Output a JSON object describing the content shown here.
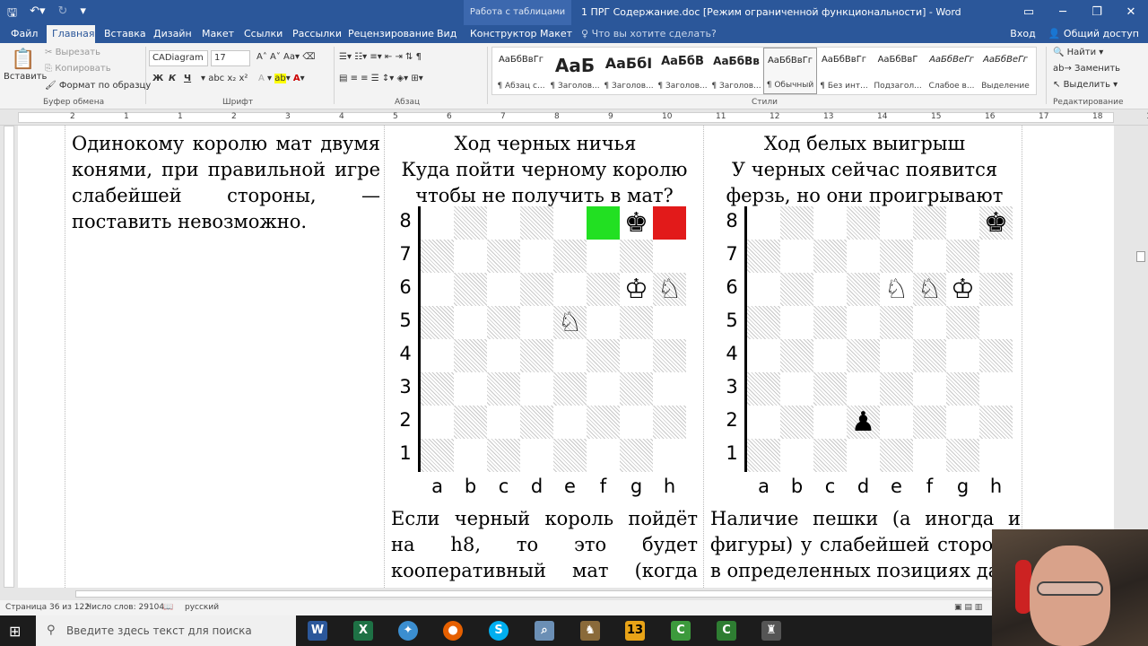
{
  "window": {
    "doc_title": "1 ПРГ Содержание.doc [Режим ограниченной функциональности] - Word",
    "context_tab": "Работа с таблицами"
  },
  "tabs": {
    "file": "Файл",
    "home": "Главная",
    "insert": "Вставка",
    "design": "Дизайн",
    "layout": "Макет",
    "references": "Ссылки",
    "mailings": "Рассылки",
    "review": "Рецензирование",
    "view": "Вид",
    "constructor": "Конструктор",
    "table_layout": "Макет",
    "tell_me": "Что вы хотите сделать?",
    "login": "Вход",
    "share": "Общий доступ"
  },
  "clipboard": {
    "paste": "Вставить",
    "cut": "Вырезать",
    "copy": "Копировать",
    "format_painter": "Формат по образцу",
    "group": "Буфер обмена"
  },
  "font": {
    "name": "CADiagram",
    "size": "17",
    "group": "Шрифт",
    "bold": "Ж",
    "italic": "К",
    "underline": "Ч"
  },
  "paragraph": {
    "group": "Абзац"
  },
  "styles": {
    "group": "Стили",
    "items": [
      {
        "preview": "АаБбВвГг",
        "name": "¶ Абзац с..."
      },
      {
        "preview": "АаБ",
        "name": "¶ Заголов..."
      },
      {
        "preview": "АаБбI",
        "name": "¶ Заголов..."
      },
      {
        "preview": "АаБбВ",
        "name": "¶ Заголов..."
      },
      {
        "preview": "АаБбВв",
        "name": "¶ Заголов..."
      },
      {
        "preview": "АаБбВвГг",
        "name": "¶ Обычный"
      },
      {
        "preview": "АаБбВвГг",
        "name": "¶ Без инт..."
      },
      {
        "preview": "АаБбВвГ",
        "name": "Подзагол..."
      },
      {
        "preview": "АаБбВеГг",
        "name": "Слабое в..."
      },
      {
        "preview": "АаБбВеГг",
        "name": "Выделение"
      }
    ]
  },
  "editing": {
    "find": "Найти",
    "replace": "Заменить",
    "select": "Выделить",
    "group": "Редактирование"
  },
  "ruler": {
    "numbers": [
      "2",
      "1",
      "1",
      "2",
      "3",
      "4",
      "5",
      "6",
      "7",
      "8",
      "9",
      "10",
      "11",
      "12",
      "13",
      "14",
      "15",
      "16",
      "17",
      "18",
      "19"
    ]
  },
  "doc": {
    "left_text": "Одинокому королю мат двумя конями, при правильной игре слабейшей стороны, — поставить невозможно.",
    "col2_title": "Ход черных ничья",
    "col2_sub": "Куда пойти черному королю чтобы не получить в мат?",
    "col3_title": "Ход белых выигрыш",
    "col3_sub": "У черных сейчас появится ферзь, но они проигрывают",
    "col2_bottom": "Если черный король пойдёт на h8, то это будет кооперативный мат (когда соперник нам",
    "col3_bottom": "Наличие пешки (а иногда и фигуры) у слабейшей стороны в определенных позициях да"
  },
  "boards": {
    "ranks": [
      "8",
      "7",
      "6",
      "5",
      "4",
      "3",
      "2",
      "1"
    ],
    "files": [
      "a",
      "b",
      "c",
      "d",
      "e",
      "f",
      "g",
      "h"
    ],
    "left": [
      [
        "",
        "",
        "",
        "",
        "",
        "#G",
        "♚",
        "#R"
      ],
      [
        "",
        "",
        "",
        "",
        "",
        "",
        "",
        ""
      ],
      [
        "",
        "",
        "",
        "",
        "",
        "",
        "♔",
        "♘"
      ],
      [
        "",
        "",
        "",
        "",
        "♘",
        "",
        "",
        ""
      ],
      [
        "",
        "",
        "",
        "",
        "",
        "",
        "",
        ""
      ],
      [
        "",
        "",
        "",
        "",
        "",
        "",
        "",
        ""
      ],
      [
        "",
        "",
        "",
        "",
        "",
        "",
        "",
        ""
      ],
      [
        "",
        "",
        "",
        "",
        "",
        "",
        "",
        ""
      ]
    ],
    "right": [
      [
        "",
        "",
        "",
        "",
        "",
        "",
        "",
        "♚"
      ],
      [
        "",
        "",
        "",
        "",
        "",
        "",
        "",
        ""
      ],
      [
        "",
        "",
        "",
        "",
        "♘",
        "♘",
        "♔",
        ""
      ],
      [
        "",
        "",
        "",
        "",
        "",
        "",
        "",
        ""
      ],
      [
        "",
        "",
        "",
        "",
        "",
        "",
        "",
        ""
      ],
      [
        "",
        "",
        "",
        "",
        "",
        "",
        "",
        ""
      ],
      [
        "",
        "",
        "",
        "♟",
        "",
        "",
        "",
        ""
      ],
      [
        "",
        "",
        "",
        "",
        "",
        "",
        "",
        ""
      ]
    ]
  },
  "status": {
    "page": "Страница 36 из 122",
    "words": "Число слов: 29104",
    "lang": "русский"
  },
  "taskbar": {
    "search": "Введите здесь текст для поиска"
  }
}
